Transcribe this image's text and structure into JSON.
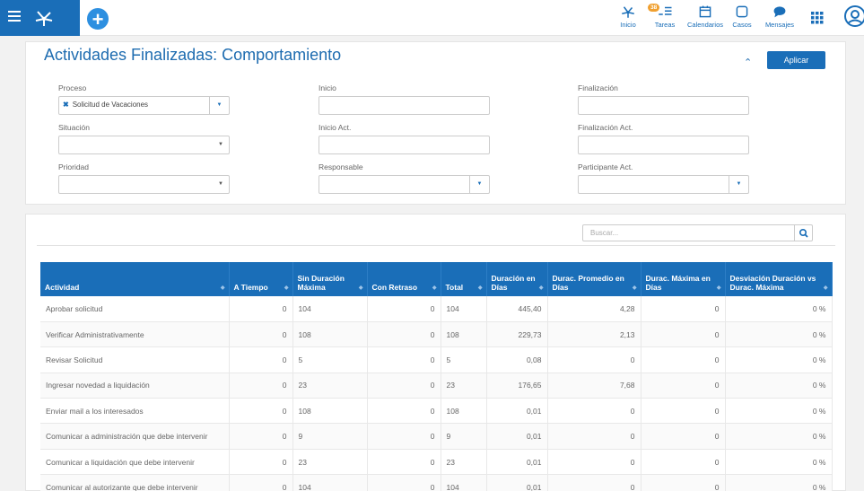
{
  "header": {
    "nav": [
      {
        "label": "Inicio",
        "icon": "inicio-icon"
      },
      {
        "label": "Tareas",
        "icon": "tareas-icon",
        "badge": "38"
      },
      {
        "label": "Calendarios",
        "icon": "calendar-icon"
      },
      {
        "label": "Casos",
        "icon": "casos-icon"
      },
      {
        "label": "Mensajes",
        "icon": "chat-icon"
      }
    ]
  },
  "filters": {
    "title": "Actividades Finalizadas: Comportamiento",
    "apply_label": "Aplicar",
    "proceso_label": "Proceso",
    "proceso_value": "Solicitud de Vacaciones",
    "inicio_label": "Inicio",
    "finalizacion_label": "Finalización",
    "situacion_label": "Situación",
    "inicio_act_label": "Inicio Act.",
    "finalizacion_act_label": "Finalización Act.",
    "prioridad_label": "Prioridad",
    "responsable_label": "Responsable",
    "participante_label": "Participante Act."
  },
  "grid": {
    "search_placeholder": "Buscar...",
    "columns": [
      "Actividad",
      "A Tiempo",
      "Sin Duración Máxima",
      "Con Retraso",
      "Total",
      "Duración en Días",
      "Durac. Promedio en Días",
      "Durac. Máxima en Días",
      "Desviación Duración vs Durac. Máxima"
    ],
    "rows": [
      [
        "Aprobar solicitud",
        "0",
        "104",
        "0",
        "104",
        "445,40",
        "4,28",
        "0",
        "0 %"
      ],
      [
        "Verificar Administrativamente",
        "0",
        "108",
        "0",
        "108",
        "229,73",
        "2,13",
        "0",
        "0 %"
      ],
      [
        "Revisar Solicitud",
        "0",
        "5",
        "0",
        "5",
        "0,08",
        "0",
        "0",
        "0 %"
      ],
      [
        "Ingresar novedad a liquidación",
        "0",
        "23",
        "0",
        "23",
        "176,65",
        "7,68",
        "0",
        "0 %"
      ],
      [
        "Enviar mail a los interesados",
        "0",
        "108",
        "0",
        "108",
        "0,01",
        "0",
        "0",
        "0 %"
      ],
      [
        "Comunicar a administración que debe intervenir",
        "0",
        "9",
        "0",
        "9",
        "0,01",
        "0",
        "0",
        "0 %"
      ],
      [
        "Comunicar a liquidación que debe intervenir",
        "0",
        "23",
        "0",
        "23",
        "0,01",
        "0",
        "0",
        "0 %"
      ],
      [
        "Comunicar al autorizante que debe intervenir",
        "0",
        "104",
        "0",
        "104",
        "0,01",
        "0",
        "0",
        "0 %"
      ]
    ]
  },
  "colors": {
    "primary": "#1a6eb8",
    "accent": "#2d8fe0",
    "badge": "#f0a030"
  }
}
